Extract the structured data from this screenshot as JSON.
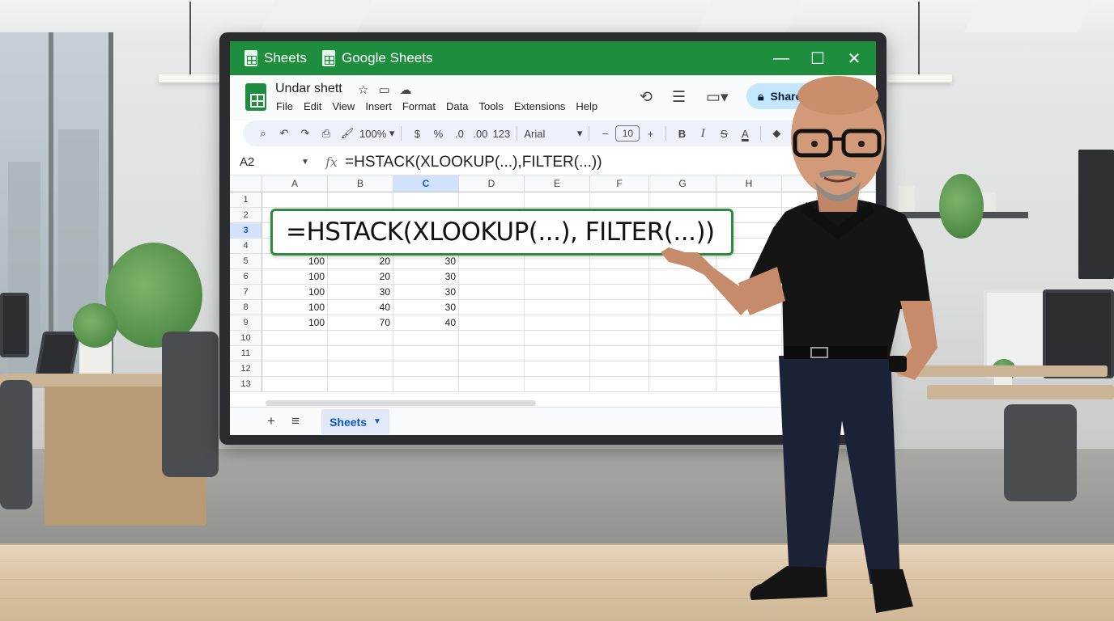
{
  "window": {
    "tabs": [
      {
        "label": "Sheets",
        "icon": "sheets-icon"
      },
      {
        "label": "Google Sheets",
        "icon": "sheets-icon"
      }
    ],
    "controls": {
      "minimize": "—",
      "maximize": "☐",
      "close": "✕"
    }
  },
  "doc": {
    "title": "Undar shett",
    "menu": [
      "File",
      "Edit",
      "View",
      "Insert",
      "Format",
      "Data",
      "Tools",
      "Extensions",
      "Help"
    ],
    "share_label": "Share"
  },
  "toolbar": {
    "zoom": "100%",
    "currency": "$",
    "percent": "%",
    "dec_decrease": ".0",
    "dec_increase": ".00",
    "number_format": "123",
    "font": "Arial",
    "minus": "−",
    "font_size": "10",
    "plus": "+",
    "bold": "B",
    "italic": "I",
    "strike": "S",
    "text_color": "A"
  },
  "formula_bar": {
    "name_box": "A2",
    "fx": "fx",
    "formula": "=HSTACK(XLOOKUP(...),FILTER(...))"
  },
  "grid": {
    "columns": [
      "A",
      "B",
      "C",
      "D",
      "E",
      "F",
      "G",
      "H"
    ],
    "selected_column": "C",
    "selected_row": "3",
    "rows": [
      {
        "n": "1",
        "cells": [
          "",
          "",
          ""
        ]
      },
      {
        "n": "2",
        "cells": [
          "",
          "",
          ""
        ]
      },
      {
        "n": "3",
        "cells": [
          "",
          "",
          ""
        ]
      },
      {
        "n": "4",
        "cells": [
          "",
          "",
          ""
        ]
      },
      {
        "n": "5",
        "cells": [
          "100",
          "20",
          "30"
        ]
      },
      {
        "n": "6",
        "cells": [
          "100",
          "20",
          "30"
        ]
      },
      {
        "n": "7",
        "cells": [
          "100",
          "30",
          "30"
        ]
      },
      {
        "n": "8",
        "cells": [
          "100",
          "40",
          "30"
        ]
      },
      {
        "n": "9",
        "cells": [
          "100",
          "70",
          "40"
        ]
      },
      {
        "n": "10",
        "cells": [
          "",
          "",
          ""
        ]
      },
      {
        "n": "11",
        "cells": [
          "",
          "",
          ""
        ]
      },
      {
        "n": "12",
        "cells": [
          "",
          "",
          ""
        ]
      },
      {
        "n": "13",
        "cells": [
          "",
          "",
          ""
        ]
      }
    ]
  },
  "sheetbar": {
    "add": "+",
    "list": "≡",
    "active_tab": "Sheets"
  },
  "callout": {
    "text": "=HSTACK(XLOOKUP(...), FILTER(...))"
  },
  "colors": {
    "title_bar": "#1e8e3e",
    "share_button": "#c2e7ff",
    "callout_border": "#2e8b3e",
    "selection": "#d3e3fd"
  }
}
